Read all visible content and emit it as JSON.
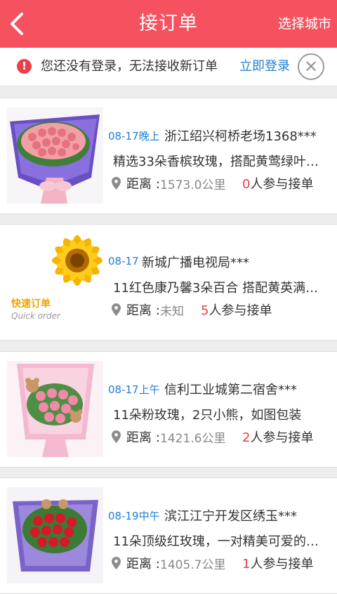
{
  "header": {
    "title": "接订单",
    "city_button": "选择城市",
    "back_icon": "chevron-left-icon"
  },
  "notice": {
    "text": "您还没有登录，无法接收新订单",
    "login_link": "立即登录",
    "warn_glyph": "!"
  },
  "colors": {
    "brand": "#f5515f",
    "link": "#1f7fd8",
    "count": "#e8414a"
  },
  "distance_label": "距离 :",
  "participant_suffix": "人参与接单",
  "orders": [
    {
      "date": "08-17晚上",
      "address": "浙江绍兴柯桥老场1368***",
      "description": "精选33朵香槟玫瑰，搭配黄莺绿叶…",
      "distance": "1573.0公里",
      "count": "0",
      "image": "pink-rose-bouquet"
    },
    {
      "date": "08-17",
      "address": "新城广播电视局***",
      "description": "11红色康乃馨3朵百合 搭配黄英满…",
      "distance": "未知",
      "count": "5",
      "image": "quick-order-sunflower",
      "badge_cn": "快速订单",
      "badge_en": "Quick order"
    },
    {
      "date": "08-17上午",
      "address": "信利工业城第二宿舍***",
      "description": "11朵粉玫瑰，2只小熊，如图包装",
      "distance": "1421.6公里",
      "count": "2",
      "image": "pink-rose-bear-bouquet"
    },
    {
      "date": "08-19中午",
      "address": "滨江江宁开发区绣玉***",
      "description": "11朵顶级红玫瑰，一对精美可爱的…",
      "distance": "1405.7公里",
      "count": "1",
      "image": "red-rose-bear-bouquet"
    }
  ]
}
